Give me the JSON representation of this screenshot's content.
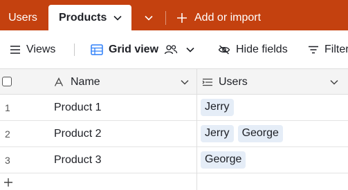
{
  "tabs": {
    "users_label": "Users",
    "products_label": "Products",
    "add_label": "Add or import"
  },
  "toolbar": {
    "views_label": "Views",
    "grid_view_label": "Grid view",
    "hide_fields_label": "Hide fields",
    "filter_label": "Filter"
  },
  "table": {
    "columns": {
      "name": "Name",
      "users": "Users"
    },
    "rows": [
      {
        "num": "1",
        "name": "Product 1",
        "users": [
          "Jerry"
        ]
      },
      {
        "num": "2",
        "name": "Product 2",
        "users": [
          "Jerry",
          "George"
        ]
      },
      {
        "num": "3",
        "name": "Product 3",
        "users": [
          "George"
        ]
      }
    ]
  },
  "colors": {
    "brand_bar": "#c4410f",
    "chip_bg": "#e5edf7",
    "grid_icon": "#2d7ff9"
  },
  "icons": {
    "tab_dropdown": "chevron-down-icon",
    "add": "plus-icon",
    "views_menu": "hamburger-icon",
    "grid_view": "grid-icon",
    "collaborators": "people-icon",
    "hide_fields": "eye-slash-icon",
    "filter": "filter-icon",
    "name_field": "text-field-icon",
    "users_field": "link-field-icon",
    "add_row": "plus-icon"
  }
}
